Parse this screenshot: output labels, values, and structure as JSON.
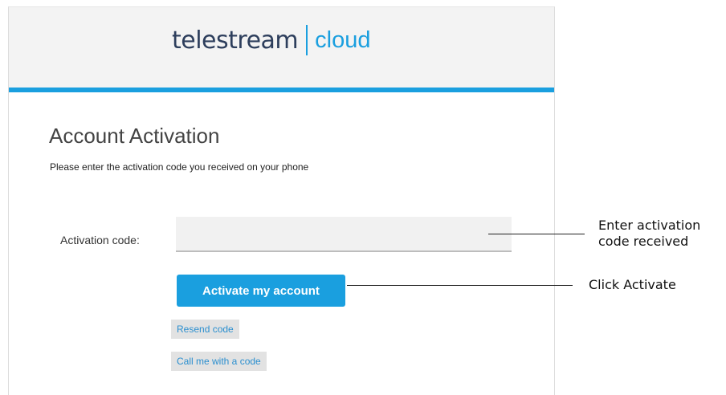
{
  "header": {
    "logo_word": "telestream",
    "logo_product": "cloud",
    "accent_color": "#1a9fdf"
  },
  "main": {
    "title": "Account Activation",
    "subtitle": "Please enter the activation code you received on your phone",
    "code_label": "Activation code:",
    "code_value": "",
    "activate_label": "Activate my account",
    "resend_label": "Resend code",
    "call_label": "Call me with a code"
  },
  "callouts": {
    "enter_line1": "Enter activation",
    "enter_line2": "code received",
    "activate": "Click Activate"
  }
}
